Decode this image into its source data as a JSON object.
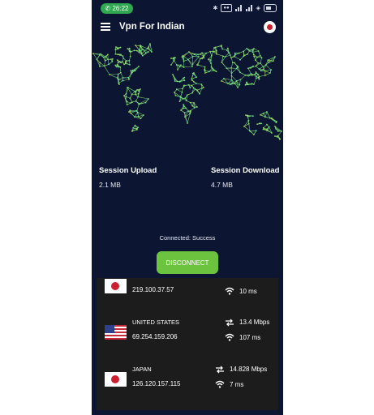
{
  "status_bar": {
    "time": "26:22"
  },
  "app_bar": {
    "title": "Vpn For Indian"
  },
  "session": {
    "upload_label": "Session Upload",
    "upload_value": "2.1 MB",
    "download_label": "Session Download",
    "download_value": "4.7 MB"
  },
  "connection": {
    "status": "Connected: Success",
    "button_label": "DISCONNECT"
  },
  "servers": [
    {
      "country": "",
      "flag": "jp-flag",
      "ip": "219.100.37.57",
      "speed": "",
      "ping": "10 ms"
    },
    {
      "country": "UNITED STATES",
      "flag": "us-flag",
      "ip": "69.254.159.206",
      "speed": "13.4 Mbps",
      "ping": "107 ms"
    },
    {
      "country": "JAPAN",
      "flag": "jp-flag",
      "ip": "126.120.157.115",
      "speed": "14.828 Mbps",
      "ping": "7 ms"
    }
  ],
  "colors": {
    "background": "#0c1633",
    "accent_green": "#6cc43e",
    "list_background": "#1c1c1c",
    "status_pill": "#2fa84f"
  }
}
